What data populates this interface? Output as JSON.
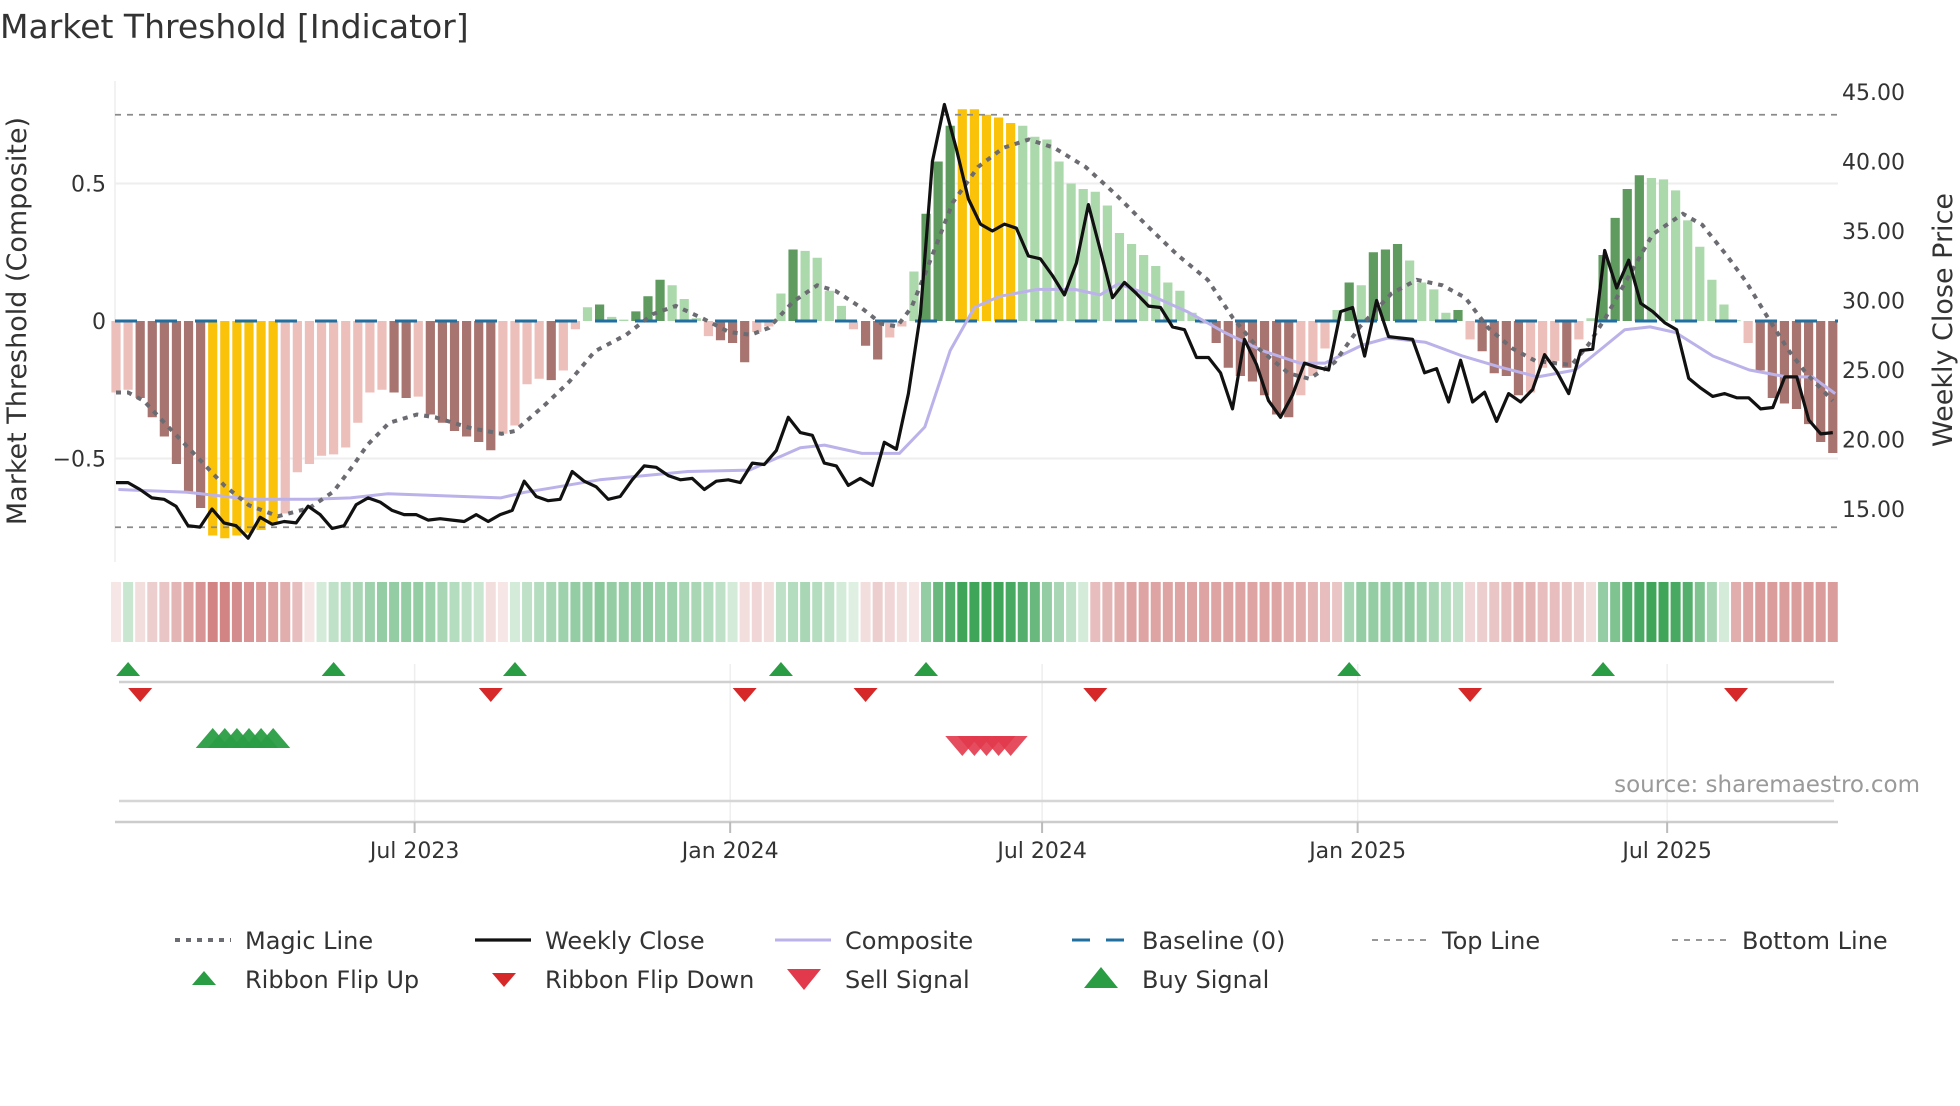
{
  "chart_data": {
    "type": "bar",
    "title": "Market Threshold [Indicator]",
    "ylabel": "Market Threshold (Composite)",
    "y2label": "Weekly Close Price",
    "source": "source: sharemaestro.com",
    "x_unit": "week index",
    "ylim": [
      -0.85,
      0.85
    ],
    "y2lim": [
      11,
      48
    ],
    "yticks": [
      {
        "v": 0.5,
        "label": "0.5"
      },
      {
        "v": 0,
        "label": "0"
      },
      {
        "v": -0.5,
        "label": "−0.5"
      }
    ],
    "y2ticks": [
      {
        "v": 45,
        "label": "45.00"
      },
      {
        "v": 40,
        "label": "40.00"
      },
      {
        "v": 35,
        "label": "35.00"
      },
      {
        "v": 30,
        "label": "30.00"
      },
      {
        "v": 25,
        "label": "25.00"
      },
      {
        "v": 20,
        "label": "20.00"
      },
      {
        "v": 15,
        "label": "15.00"
      }
    ],
    "xticks": [
      {
        "week": 24.7,
        "label": "Jul 2023"
      },
      {
        "week": 50.8,
        "label": "Jan 2024"
      },
      {
        "week": 76.6,
        "label": "Jul 2024"
      },
      {
        "week": 102.7,
        "label": "Jan 2025"
      },
      {
        "week": 128.3,
        "label": "Jul 2025"
      }
    ],
    "top_line": 0.75,
    "bottom_line": -0.75,
    "baseline": 0,
    "colors": {
      "dark_red": "#a87470",
      "light_red": "#ecbfba",
      "dark_green": "#5f9a5f",
      "light_green": "#acd9ab",
      "signal_yellow": "#fbc20a",
      "magic": "#6b6b72",
      "close": "#111111",
      "composite": "#bbb2ea",
      "baseline": "#1f6fa0",
      "threshold": "#8a8a8a",
      "flip_up": "#2a9d44",
      "flip_down": "#d62828",
      "buy": "#2a9d44",
      "sell": "#e23a4c"
    },
    "composite_bars": [
      -0.26,
      -0.25,
      -0.28,
      -0.35,
      -0.42,
      -0.52,
      -0.62,
      -0.68,
      -0.78,
      -0.79,
      -0.78,
      -0.77,
      -0.76,
      -0.74,
      -0.7,
      -0.55,
      -0.52,
      -0.49,
      -0.485,
      -0.46,
      -0.37,
      -0.26,
      -0.25,
      -0.26,
      -0.28,
      -0.275,
      -0.34,
      -0.37,
      -0.4,
      -0.42,
      -0.44,
      -0.47,
      -0.41,
      -0.38,
      -0.23,
      -0.21,
      -0.215,
      -0.18,
      -0.03,
      0.05,
      0.06,
      0.015,
      0.005,
      0.035,
      0.09,
      0.15,
      0.13,
      0.08,
      0.01,
      -0.055,
      -0.07,
      -0.08,
      -0.15,
      -0.04,
      -0.02,
      0.1,
      0.26,
      0.255,
      0.23,
      0.11,
      0.055,
      -0.03,
      -0.09,
      -0.14,
      -0.06,
      -0.02,
      0.18,
      0.39,
      0.58,
      0.71,
      0.77,
      0.77,
      0.75,
      0.74,
      0.72,
      0.71,
      0.67,
      0.66,
      0.58,
      0.5,
      0.48,
      0.47,
      0.42,
      0.32,
      0.28,
      0.24,
      0.2,
      0.14,
      0.11,
      0.03,
      -0.01,
      -0.08,
      -0.17,
      -0.2,
      -0.22,
      -0.27,
      -0.34,
      -0.35,
      -0.27,
      -0.2,
      -0.1,
      0.04,
      0.14,
      0.13,
      0.25,
      0.26,
      0.28,
      0.22,
      0.14,
      0.115,
      0.03,
      0.04,
      -0.067,
      -0.11,
      -0.19,
      -0.2,
      -0.27,
      -0.26,
      -0.17,
      -0.145,
      -0.17,
      -0.067,
      0.01,
      0.24,
      0.375,
      0.48,
      0.53,
      0.52,
      0.515,
      0.475,
      0.366,
      0.27,
      0.15,
      0.06,
      0.003,
      -0.08,
      -0.18,
      -0.28,
      -0.3,
      -0.32,
      -0.375,
      -0.44,
      -0.48
    ],
    "magic_line": [
      [
        0,
        -0.26
      ],
      [
        1,
        -0.26
      ],
      [
        2.3,
        -0.29
      ],
      [
        4,
        -0.37
      ],
      [
        6.4,
        -0.48
      ],
      [
        9,
        -0.6
      ],
      [
        11,
        -0.67
      ],
      [
        13.4,
        -0.71
      ],
      [
        16,
        -0.68
      ],
      [
        18,
        -0.62
      ],
      [
        19.7,
        -0.52
      ],
      [
        20.8,
        -0.45
      ],
      [
        22.6,
        -0.37
      ],
      [
        24.9,
        -0.34
      ],
      [
        26.4,
        -0.35
      ],
      [
        29.4,
        -0.39
      ],
      [
        31.9,
        -0.41
      ],
      [
        33,
        -0.4
      ],
      [
        35.6,
        -0.3
      ],
      [
        37.5,
        -0.22
      ],
      [
        39.6,
        -0.11
      ],
      [
        42.2,
        -0.05
      ],
      [
        44.4,
        0.025
      ],
      [
        46.3,
        0.055
      ],
      [
        48.5,
        0.01
      ],
      [
        50.7,
        -0.04
      ],
      [
        52.5,
        -0.05
      ],
      [
        54,
        -0.025
      ],
      [
        56,
        0.07
      ],
      [
        58,
        0.13
      ],
      [
        59.5,
        0.11
      ],
      [
        61.6,
        0.05
      ],
      [
        63.3,
        -0.01
      ],
      [
        64.6,
        -0.02
      ],
      [
        65.8,
        0.05
      ],
      [
        67,
        0.18
      ],
      [
        69.2,
        0.43
      ],
      [
        71.3,
        0.56
      ],
      [
        73.4,
        0.63
      ],
      [
        75.5,
        0.66
      ],
      [
        77.6,
        0.63
      ],
      [
        80.2,
        0.56
      ],
      [
        82.7,
        0.46
      ],
      [
        85.2,
        0.35
      ],
      [
        87.8,
        0.24
      ],
      [
        90.3,
        0.15
      ],
      [
        92.4,
        0.01
      ],
      [
        94.5,
        -0.1
      ],
      [
        97,
        -0.19
      ],
      [
        98.7,
        -0.21
      ],
      [
        100.8,
        -0.15
      ],
      [
        102.9,
        -0.02
      ],
      [
        105.5,
        0.1
      ],
      [
        107.6,
        0.15
      ],
      [
        109.7,
        0.13
      ],
      [
        111.6,
        0.085
      ],
      [
        113.5,
        -0.025
      ],
      [
        115.5,
        -0.1
      ],
      [
        117.4,
        -0.145
      ],
      [
        120.4,
        -0.16
      ],
      [
        121.8,
        -0.085
      ],
      [
        123.2,
        0.012
      ],
      [
        124.9,
        0.145
      ],
      [
        127.1,
        0.315
      ],
      [
        129.6,
        0.39
      ],
      [
        131.2,
        0.35
      ],
      [
        133.2,
        0.24
      ],
      [
        134.8,
        0.145
      ],
      [
        136.8,
        0
      ],
      [
        138.4,
        -0.11
      ],
      [
        139.8,
        -0.19
      ],
      [
        142,
        -0.29
      ]
    ],
    "weekly_close": [
      16.9,
      16.9,
      16.4,
      15.8,
      15.7,
      15.2,
      13.8,
      13.7,
      15.0,
      14.0,
      13.8,
      12.9,
      14.4,
      13.9,
      14.1,
      14.0,
      15.2,
      14.6,
      13.6,
      13.8,
      15.3,
      15.8,
      15.5,
      14.9,
      14.6,
      14.6,
      14.2,
      14.3,
      14.2,
      14.1,
      14.6,
      14.1,
      14.6,
      14.9,
      17.0,
      15.9,
      15.6,
      15.7,
      17.7,
      17.0,
      16.6,
      15.7,
      15.9,
      17.1,
      18.1,
      18.0,
      17.4,
      17.1,
      17.2,
      16.4,
      17.0,
      17.1,
      16.9,
      18.3,
      18.2,
      19.2,
      21.6,
      20.5,
      20.3,
      18.3,
      18.1,
      16.7,
      17.2,
      16.7,
      19.8,
      19.3,
      23.3,
      29.0,
      40.0,
      44.1,
      40.9,
      37.3,
      35.5,
      35.0,
      35.5,
      35.2,
      33.2,
      33.0,
      31.8,
      30.4,
      32.7,
      36.9,
      33.6,
      30.2,
      31.3,
      30.5,
      29.6,
      29.5,
      28.1,
      27.9,
      25.9,
      25.9,
      24.8,
      22.2,
      27.2,
      25.4,
      22.8,
      21.6,
      23.2,
      25.5,
      25.2,
      25.0,
      29.2,
      29.5,
      26.0,
      30.0,
      27.4,
      27.3,
      27.2,
      24.8,
      25.1,
      22.7,
      25.7,
      22.7,
      23.4,
      21.3,
      23.3,
      22.7,
      23.6,
      26.1,
      24.9,
      23.3,
      26.4,
      26.5,
      33.6,
      30.9,
      32.9,
      29.8,
      29.2,
      28.4,
      27.9,
      24.4,
      23.7,
      23.1,
      23.3,
      23.0,
      23.0,
      22.2,
      22.3,
      24.5,
      24.5,
      21.4,
      20.4,
      20.5
    ],
    "composite_price_line": [
      [
        0.2,
        16.4
      ],
      [
        5.9,
        16.2
      ],
      [
        11.1,
        15.7
      ],
      [
        16.2,
        15.7
      ],
      [
        19.4,
        15.8
      ],
      [
        22.5,
        16.1
      ],
      [
        31.8,
        15.8
      ],
      [
        33.8,
        16.2
      ],
      [
        35.9,
        16.5
      ],
      [
        40,
        17.1
      ],
      [
        47.3,
        17.7
      ],
      [
        52.4,
        17.8
      ],
      [
        56.6,
        19.4
      ],
      [
        58.6,
        19.6
      ],
      [
        61.7,
        19.0
      ],
      [
        64.8,
        19.0
      ],
      [
        66.9,
        20.9
      ],
      [
        69,
        26.4
      ],
      [
        71,
        29.5
      ],
      [
        73.1,
        30.3
      ],
      [
        76.2,
        30.8
      ],
      [
        79.3,
        30.8
      ],
      [
        81.4,
        30.4
      ],
      [
        82.9,
        31.2
      ],
      [
        85.5,
        30.4
      ],
      [
        88.6,
        29.2
      ],
      [
        91.7,
        27.7
      ],
      [
        94.8,
        26.4
      ],
      [
        97.9,
        25.5
      ],
      [
        100,
        25.5
      ],
      [
        103.1,
        26.8
      ],
      [
        105.2,
        27.3
      ],
      [
        108.3,
        27.0
      ],
      [
        111.4,
        26.0
      ],
      [
        114.5,
        25.2
      ],
      [
        117.6,
        24.5
      ],
      [
        120.7,
        25.0
      ],
      [
        122.7,
        26.4
      ],
      [
        124.8,
        27.9
      ],
      [
        126.9,
        28.1
      ],
      [
        129,
        27.7
      ],
      [
        132.1,
        26.0
      ],
      [
        135.1,
        25.0
      ],
      [
        138.2,
        24.5
      ],
      [
        140.3,
        24.5
      ],
      [
        142.2,
        23.3
      ]
    ],
    "ribbon": [
      -0.15,
      0.25,
      -0.2,
      -0.3,
      -0.35,
      -0.45,
      -0.55,
      -0.65,
      -0.75,
      -0.75,
      -0.7,
      -0.65,
      -0.6,
      -0.55,
      -0.5,
      -0.4,
      -0.15,
      0.2,
      0.3,
      0.35,
      0.4,
      0.45,
      0.5,
      0.5,
      0.5,
      0.5,
      0.45,
      0.4,
      0.35,
      0.3,
      0.25,
      -0.2,
      -0.15,
      0.2,
      0.3,
      0.35,
      0.4,
      0.45,
      0.5,
      0.5,
      0.55,
      0.5,
      0.5,
      0.5,
      0.5,
      0.45,
      0.45,
      0.4,
      0.4,
      0.35,
      0.3,
      0.2,
      -0.2,
      -0.25,
      -0.2,
      0.3,
      0.35,
      0.4,
      0.35,
      0.3,
      0.2,
      0.15,
      -0.2,
      -0.3,
      -0.25,
      -0.2,
      -0.15,
      0.5,
      0.7,
      0.8,
      0.9,
      0.9,
      0.9,
      0.9,
      0.85,
      0.8,
      0.7,
      0.5,
      0.4,
      0.3,
      0.2,
      -0.4,
      -0.45,
      -0.5,
      -0.55,
      -0.55,
      -0.55,
      -0.55,
      -0.55,
      -0.55,
      -0.55,
      -0.55,
      -0.55,
      -0.55,
      -0.55,
      -0.55,
      -0.55,
      -0.5,
      -0.5,
      -0.45,
      -0.4,
      -0.35,
      0.4,
      0.5,
      0.5,
      0.5,
      0.5,
      0.5,
      0.45,
      0.4,
      0.35,
      0.3,
      -0.25,
      -0.3,
      -0.35,
      -0.4,
      -0.45,
      -0.45,
      -0.4,
      -0.4,
      -0.35,
      -0.3,
      -0.2,
      0.5,
      0.6,
      0.8,
      0.85,
      0.9,
      0.9,
      0.85,
      0.8,
      0.6,
      0.4,
      0.2,
      -0.5,
      -0.55,
      -0.6,
      -0.6,
      -0.6,
      -0.6,
      -0.6,
      -0.6,
      -0.6
    ],
    "ribbon_flip_up": [
      1,
      18,
      33,
      55,
      67,
      102,
      123
    ],
    "ribbon_flip_down": [
      2,
      31,
      52,
      62,
      81,
      112,
      134
    ],
    "buy_signals": [
      8,
      9,
      10,
      11,
      12,
      13
    ],
    "sell_signals": [
      70,
      71,
      72,
      73,
      74
    ],
    "legend": [
      {
        "key": "magic",
        "label": "Magic Line"
      },
      {
        "key": "close",
        "label": "Weekly Close"
      },
      {
        "key": "composite",
        "label": "Composite"
      },
      {
        "key": "baseline",
        "label": "Baseline (0)"
      },
      {
        "key": "top",
        "label": "Top Line"
      },
      {
        "key": "bottom",
        "label": "Bottom Line"
      },
      {
        "key": "flip_up",
        "label": "Ribbon Flip Up"
      },
      {
        "key": "flip_down",
        "label": "Ribbon Flip Down"
      },
      {
        "key": "sell",
        "label": "Sell Signal"
      },
      {
        "key": "buy",
        "label": "Buy Signal"
      }
    ]
  }
}
